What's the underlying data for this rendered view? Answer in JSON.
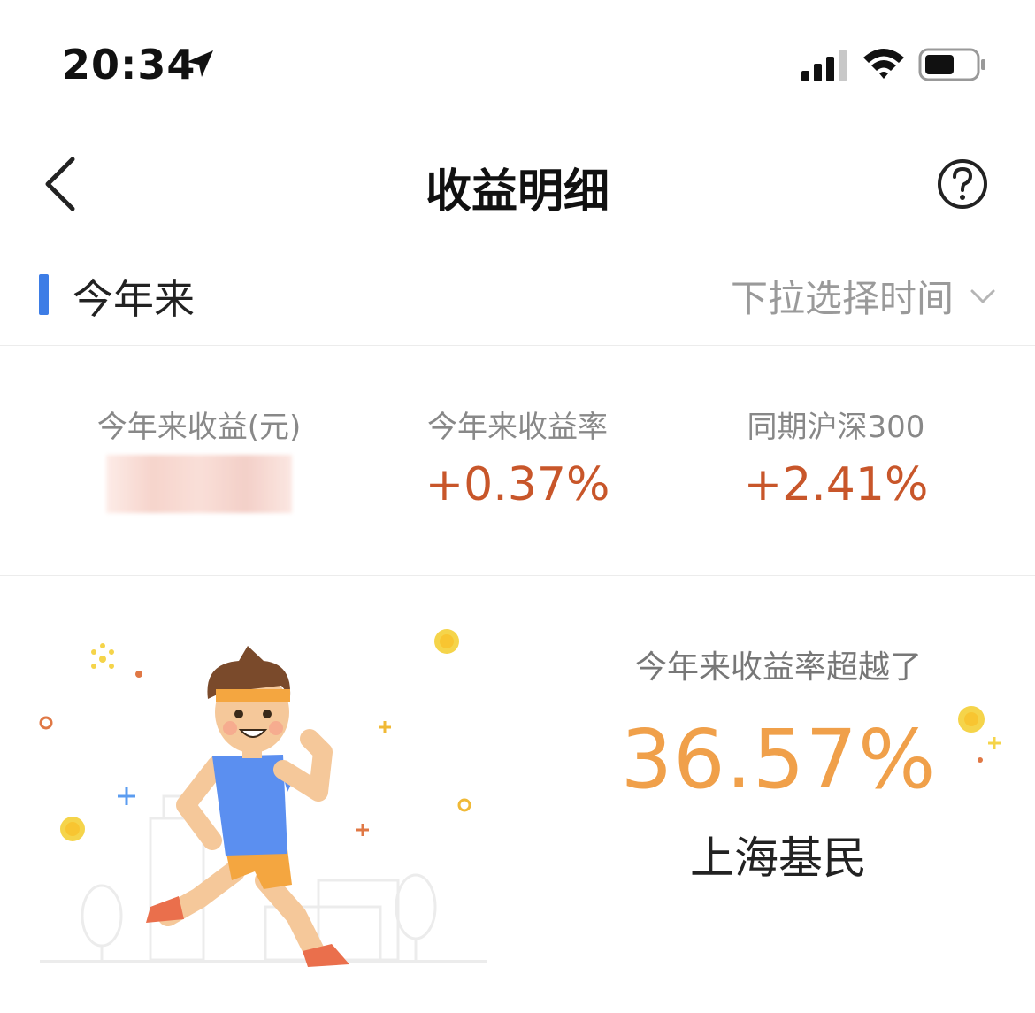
{
  "status_bar": {
    "time": "20:34"
  },
  "nav": {
    "title": "收益明细"
  },
  "period": {
    "label": "今年来",
    "picker": "下拉选择时间"
  },
  "stats": [
    {
      "label": "今年来收益(元)"
    },
    {
      "label": "今年来收益率",
      "value": "+0.37%"
    },
    {
      "label": "同期沪深300",
      "value": "+2.41%"
    }
  ],
  "hero": {
    "label": "今年来收益率超越了",
    "value": "36.57%",
    "subject": "上海基民"
  },
  "colors": {
    "accent": "#3d7de6",
    "gain": "#c8562a",
    "highlight": "#f0a04a"
  }
}
